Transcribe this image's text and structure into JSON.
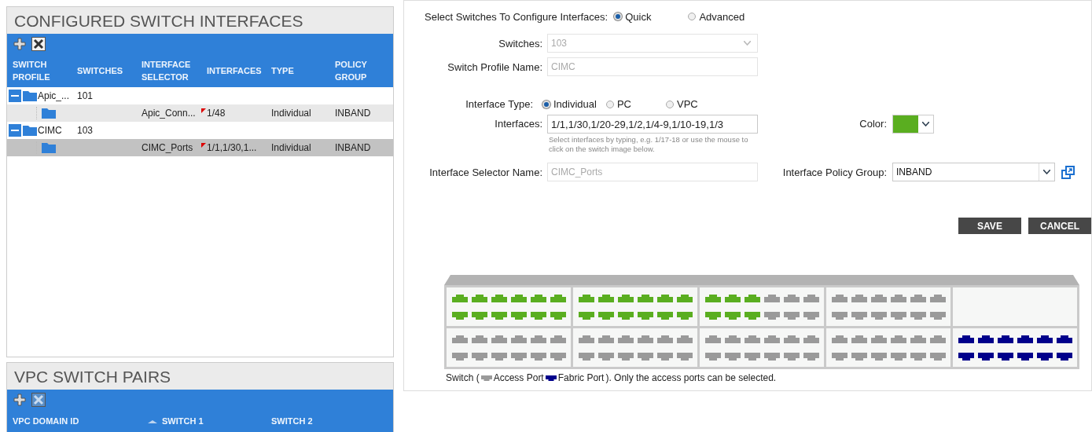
{
  "interfaces_panel": {
    "title": "CONFIGURED SWITCH INTERFACES",
    "delete_button": {
      "disabled": false
    },
    "columns": [
      "SWITCH PROFILE",
      "SWITCHES",
      "INTERFACE SELECTOR",
      "INTERFACES",
      "TYPE",
      "POLICY GROUP"
    ],
    "rows": [
      {
        "profile": "Apic_...",
        "switches": "101",
        "expanded": true,
        "children": [
          {
            "selector": "Apic_Conn...",
            "interfaces": "1/48",
            "type": "Individual",
            "policy_group": "INBAND",
            "flagged": true,
            "selected": false
          }
        ]
      },
      {
        "profile": "CIMC",
        "switches": "103",
        "expanded": true,
        "children": [
          {
            "selector": "CIMC_Ports",
            "interfaces": "1/1,1/30,1...",
            "type": "Individual",
            "policy_group": "INBAND",
            "flagged": true,
            "selected": true
          }
        ]
      }
    ]
  },
  "vpc_panel": {
    "title": "VPC SWITCH PAIRS",
    "delete_button": {
      "disabled": true
    },
    "columns": [
      {
        "label": "VPC DOMAIN ID",
        "sorted": false
      },
      {
        "label": "SWITCH 1",
        "sorted": true
      },
      {
        "label": "SWITCH 2",
        "sorted": false
      }
    ]
  },
  "form": {
    "mode": {
      "label": "Select Switches To Configure Interfaces:",
      "options": [
        {
          "label": "Quick",
          "selected": true
        },
        {
          "label": "Advanced",
          "selected": false
        }
      ]
    },
    "switches": {
      "label": "Switches:",
      "value": "103",
      "disabled": true
    },
    "profile_name": {
      "label": "Switch Profile Name:",
      "value": "CIMC",
      "disabled": true
    },
    "interface_type": {
      "label": "Interface Type:",
      "options": [
        {
          "label": "Individual",
          "selected": true
        },
        {
          "label": "PC",
          "selected": false
        },
        {
          "label": "VPC",
          "selected": false
        }
      ]
    },
    "interfaces": {
      "label": "Interfaces:",
      "value": "1/1,1/30,1/20-29,1/2,1/4-9,1/10-19,1/3",
      "hint": "Select interfaces by typing, e.g. 1/17-18 or use the mouse to click on the switch image below."
    },
    "color": {
      "label": "Color:",
      "color": "#5aae20"
    },
    "selector_name": {
      "label": "Interface Selector Name:",
      "value": "CIMC_Ports",
      "disabled": true
    },
    "policy_group": {
      "label": "Interface Policy Group:",
      "value": "INBAND"
    },
    "buttons": [
      "SAVE",
      "CANCEL"
    ]
  },
  "switch": {
    "blocks": [
      {
        "kind": "ports",
        "ports": [
          {
            "kind": "access",
            "selected": true
          },
          {
            "kind": "access",
            "selected": true
          },
          {
            "kind": "access",
            "selected": true
          },
          {
            "kind": "access",
            "selected": true
          },
          {
            "kind": "access",
            "selected": true
          },
          {
            "kind": "access",
            "selected": true
          },
          {
            "kind": "access",
            "selected": true
          },
          {
            "kind": "access",
            "selected": true
          },
          {
            "kind": "access",
            "selected": true
          },
          {
            "kind": "access",
            "selected": true
          },
          {
            "kind": "access",
            "selected": true
          },
          {
            "kind": "access",
            "selected": true
          }
        ]
      },
      {
        "kind": "ports",
        "ports": [
          {
            "kind": "access",
            "selected": true
          },
          {
            "kind": "access",
            "selected": true
          },
          {
            "kind": "access",
            "selected": true
          },
          {
            "kind": "access",
            "selected": true
          },
          {
            "kind": "access",
            "selected": true
          },
          {
            "kind": "access",
            "selected": true
          },
          {
            "kind": "access",
            "selected": true
          },
          {
            "kind": "access",
            "selected": true
          },
          {
            "kind": "access",
            "selected": true
          },
          {
            "kind": "access",
            "selected": true
          },
          {
            "kind": "access",
            "selected": true
          },
          {
            "kind": "access",
            "selected": true
          }
        ]
      },
      {
        "kind": "ports",
        "ports": [
          {
            "kind": "access",
            "selected": true
          },
          {
            "kind": "access",
            "selected": true
          },
          {
            "kind": "access",
            "selected": true
          },
          {
            "kind": "access",
            "selected": false
          },
          {
            "kind": "access",
            "selected": false
          },
          {
            "kind": "access",
            "selected": false
          },
          {
            "kind": "access",
            "selected": true
          },
          {
            "kind": "access",
            "selected": true
          },
          {
            "kind": "access",
            "selected": true
          },
          {
            "kind": "access",
            "selected": false
          },
          {
            "kind": "access",
            "selected": false
          },
          {
            "kind": "access",
            "selected": false
          }
        ]
      },
      {
        "kind": "ports",
        "ports": [
          {
            "kind": "access",
            "selected": false
          },
          {
            "kind": "access",
            "selected": false
          },
          {
            "kind": "access",
            "selected": false
          },
          {
            "kind": "access",
            "selected": false
          },
          {
            "kind": "access",
            "selected": false
          },
          {
            "kind": "access",
            "selected": false
          },
          {
            "kind": "access",
            "selected": false
          },
          {
            "kind": "access",
            "selected": false
          },
          {
            "kind": "access",
            "selected": false
          },
          {
            "kind": "access",
            "selected": false
          },
          {
            "kind": "access",
            "selected": false
          },
          {
            "kind": "access",
            "selected": false
          }
        ]
      },
      {
        "kind": "empty"
      },
      {
        "kind": "ports",
        "ports": [
          {
            "kind": "access",
            "selected": false
          },
          {
            "kind": "access",
            "selected": false
          },
          {
            "kind": "access",
            "selected": false
          },
          {
            "kind": "access",
            "selected": false
          },
          {
            "kind": "access",
            "selected": false
          },
          {
            "kind": "access",
            "selected": false
          },
          {
            "kind": "access",
            "selected": false
          },
          {
            "kind": "access",
            "selected": false
          },
          {
            "kind": "access",
            "selected": false
          },
          {
            "kind": "access",
            "selected": false
          },
          {
            "kind": "access",
            "selected": false
          },
          {
            "kind": "access",
            "selected": false
          }
        ]
      },
      {
        "kind": "ports",
        "ports": [
          {
            "kind": "access",
            "selected": false
          },
          {
            "kind": "access",
            "selected": false
          },
          {
            "kind": "access",
            "selected": false
          },
          {
            "kind": "access",
            "selected": false
          },
          {
            "kind": "access",
            "selected": false
          },
          {
            "kind": "access",
            "selected": false
          },
          {
            "kind": "access",
            "selected": false
          },
          {
            "kind": "access",
            "selected": false
          },
          {
            "kind": "access",
            "selected": false
          },
          {
            "kind": "access",
            "selected": false
          },
          {
            "kind": "access",
            "selected": false
          },
          {
            "kind": "access",
            "selected": false
          }
        ]
      },
      {
        "kind": "ports",
        "ports": [
          {
            "kind": "access",
            "selected": false
          },
          {
            "kind": "access",
            "selected": false
          },
          {
            "kind": "access",
            "selected": false
          },
          {
            "kind": "access",
            "selected": false
          },
          {
            "kind": "access",
            "selected": false
          },
          {
            "kind": "access",
            "selected": false
          },
          {
            "kind": "access",
            "selected": false
          },
          {
            "kind": "access",
            "selected": false
          },
          {
            "kind": "access",
            "selected": false
          },
          {
            "kind": "access",
            "selected": false
          },
          {
            "kind": "access",
            "selected": false
          },
          {
            "kind": "access",
            "selected": false
          }
        ]
      },
      {
        "kind": "ports",
        "ports": [
          {
            "kind": "access",
            "selected": false
          },
          {
            "kind": "access",
            "selected": false
          },
          {
            "kind": "access",
            "selected": false
          },
          {
            "kind": "access",
            "selected": false
          },
          {
            "kind": "access",
            "selected": false
          },
          {
            "kind": "access",
            "selected": false
          },
          {
            "kind": "access",
            "selected": false
          },
          {
            "kind": "access",
            "selected": false
          },
          {
            "kind": "access",
            "selected": false
          },
          {
            "kind": "access",
            "selected": false
          },
          {
            "kind": "access",
            "selected": false
          },
          {
            "kind": "access",
            "selected": false
          }
        ]
      },
      {
        "kind": "ports",
        "ports": [
          {
            "kind": "fabric"
          },
          {
            "kind": "fabric"
          },
          {
            "kind": "fabric"
          },
          {
            "kind": "fabric"
          },
          {
            "kind": "fabric"
          },
          {
            "kind": "fabric"
          },
          {
            "kind": "fabric"
          },
          {
            "kind": "fabric"
          },
          {
            "kind": "fabric"
          },
          {
            "kind": "fabric"
          },
          {
            "kind": "fabric"
          },
          {
            "kind": "fabric"
          }
        ]
      }
    ],
    "legend": {
      "prefix": "Switch (",
      "access": "Access Port",
      "fabric": "Fabric Port",
      "suffix": "). Only the access ports can be selected."
    }
  }
}
